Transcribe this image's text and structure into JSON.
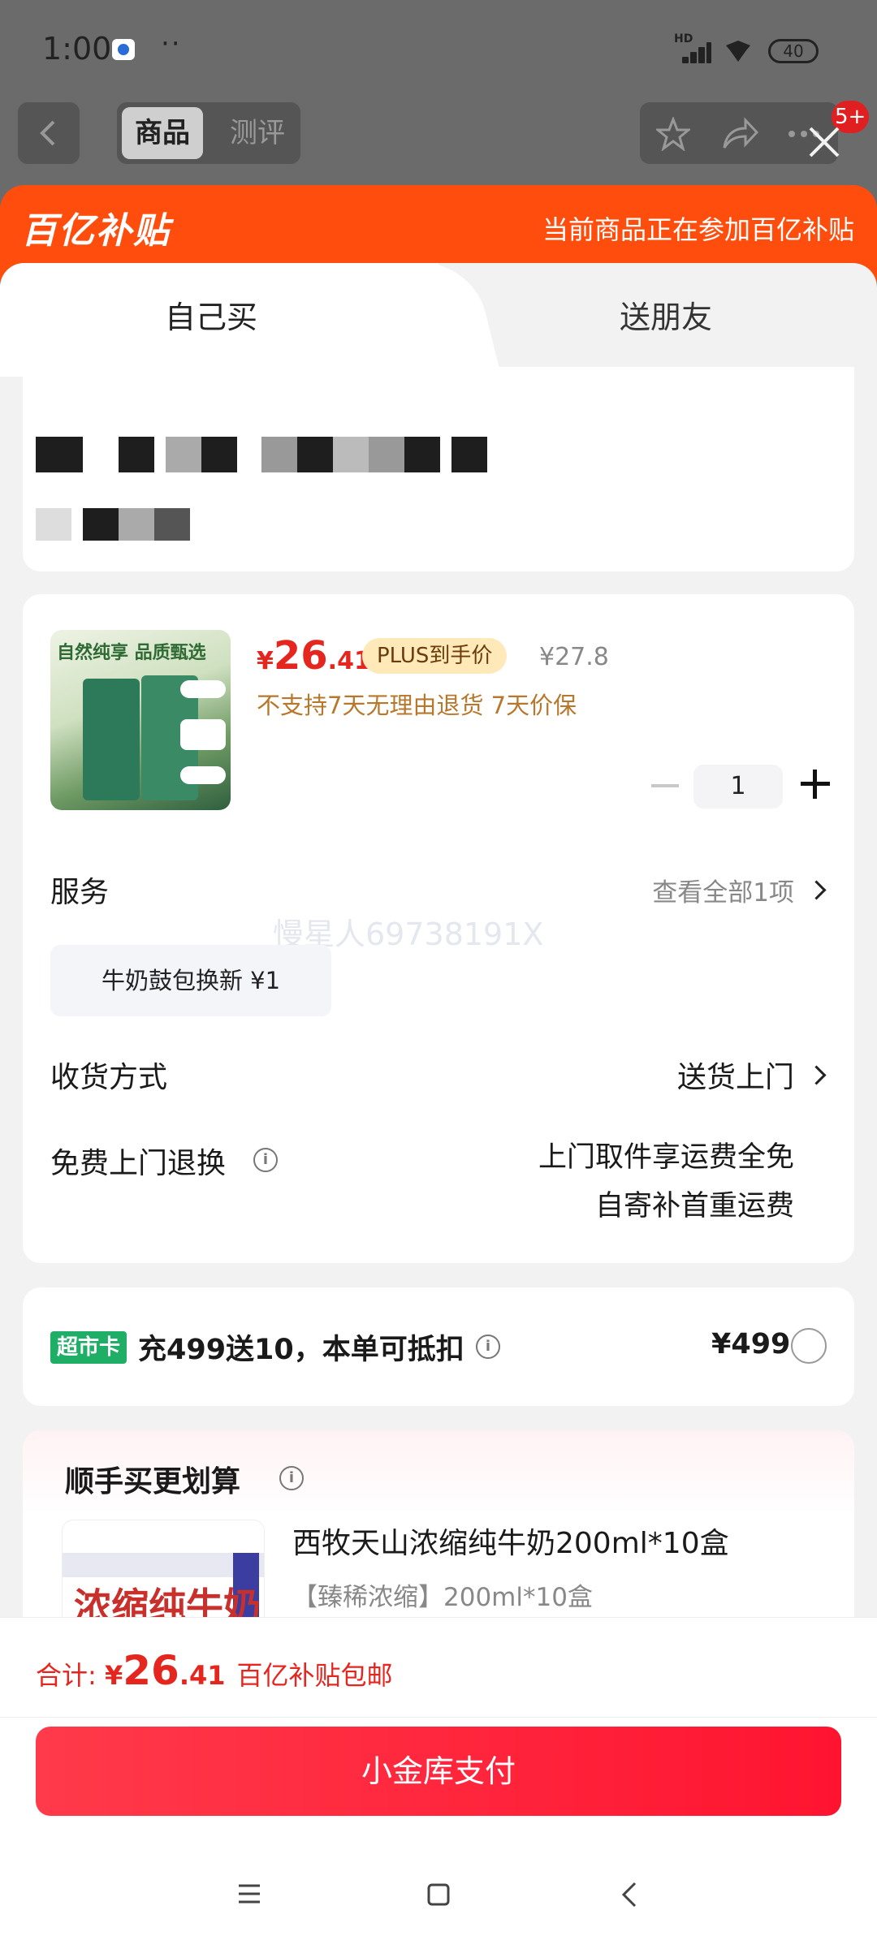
{
  "status_bar": {
    "time": "1:00",
    "dots": "··",
    "network": "HD",
    "battery": "40"
  },
  "nav": {
    "back_icon": "chevron-left-icon",
    "tab_product": "商品",
    "tab_review": "测评",
    "notification_badge": "5+"
  },
  "sheet": {
    "logo_text": "百亿补贴",
    "promo_text": "当前商品正在参加百亿补贴",
    "tabs": {
      "self": "自己买",
      "friend": "送朋友"
    }
  },
  "product": {
    "image_caption": "自然纯享 品质甄选",
    "price_currency": "¥",
    "price_int": "26",
    "price_dec": ".41",
    "plus_tag": "PLUS到手价",
    "original_price": "¥27.8",
    "notice": "不支持7天无理由退货  7天价保",
    "quantity": "1"
  },
  "service": {
    "label": "服务",
    "view_all": "查看全部1项",
    "chip": "牛奶鼓包换新  ¥1"
  },
  "watermark": "慢星人697381​91X",
  "delivery": {
    "label": "收货方式",
    "value": "送货上门"
  },
  "returns": {
    "label": "免费上门退换",
    "line1": "上门取件享运费全免",
    "line2": "自寄补首重运费"
  },
  "card_offer": {
    "tag": "超市卡",
    "text": "充499送10，本单可抵扣",
    "price": "¥499"
  },
  "upsell": {
    "title": "顺手买更划算",
    "item_name": "西牧天山浓缩纯牛奶200ml*10盒",
    "item_spec": "【臻稀浓缩】200ml*10盒",
    "image_text": "浓缩纯牛奶"
  },
  "footer": {
    "total_label": "合计: ",
    "total_currency": "¥",
    "total_int": "26",
    "total_dec": ".41",
    "shipping_note": "百亿补贴包邮",
    "pay_button": "小金库支付"
  }
}
